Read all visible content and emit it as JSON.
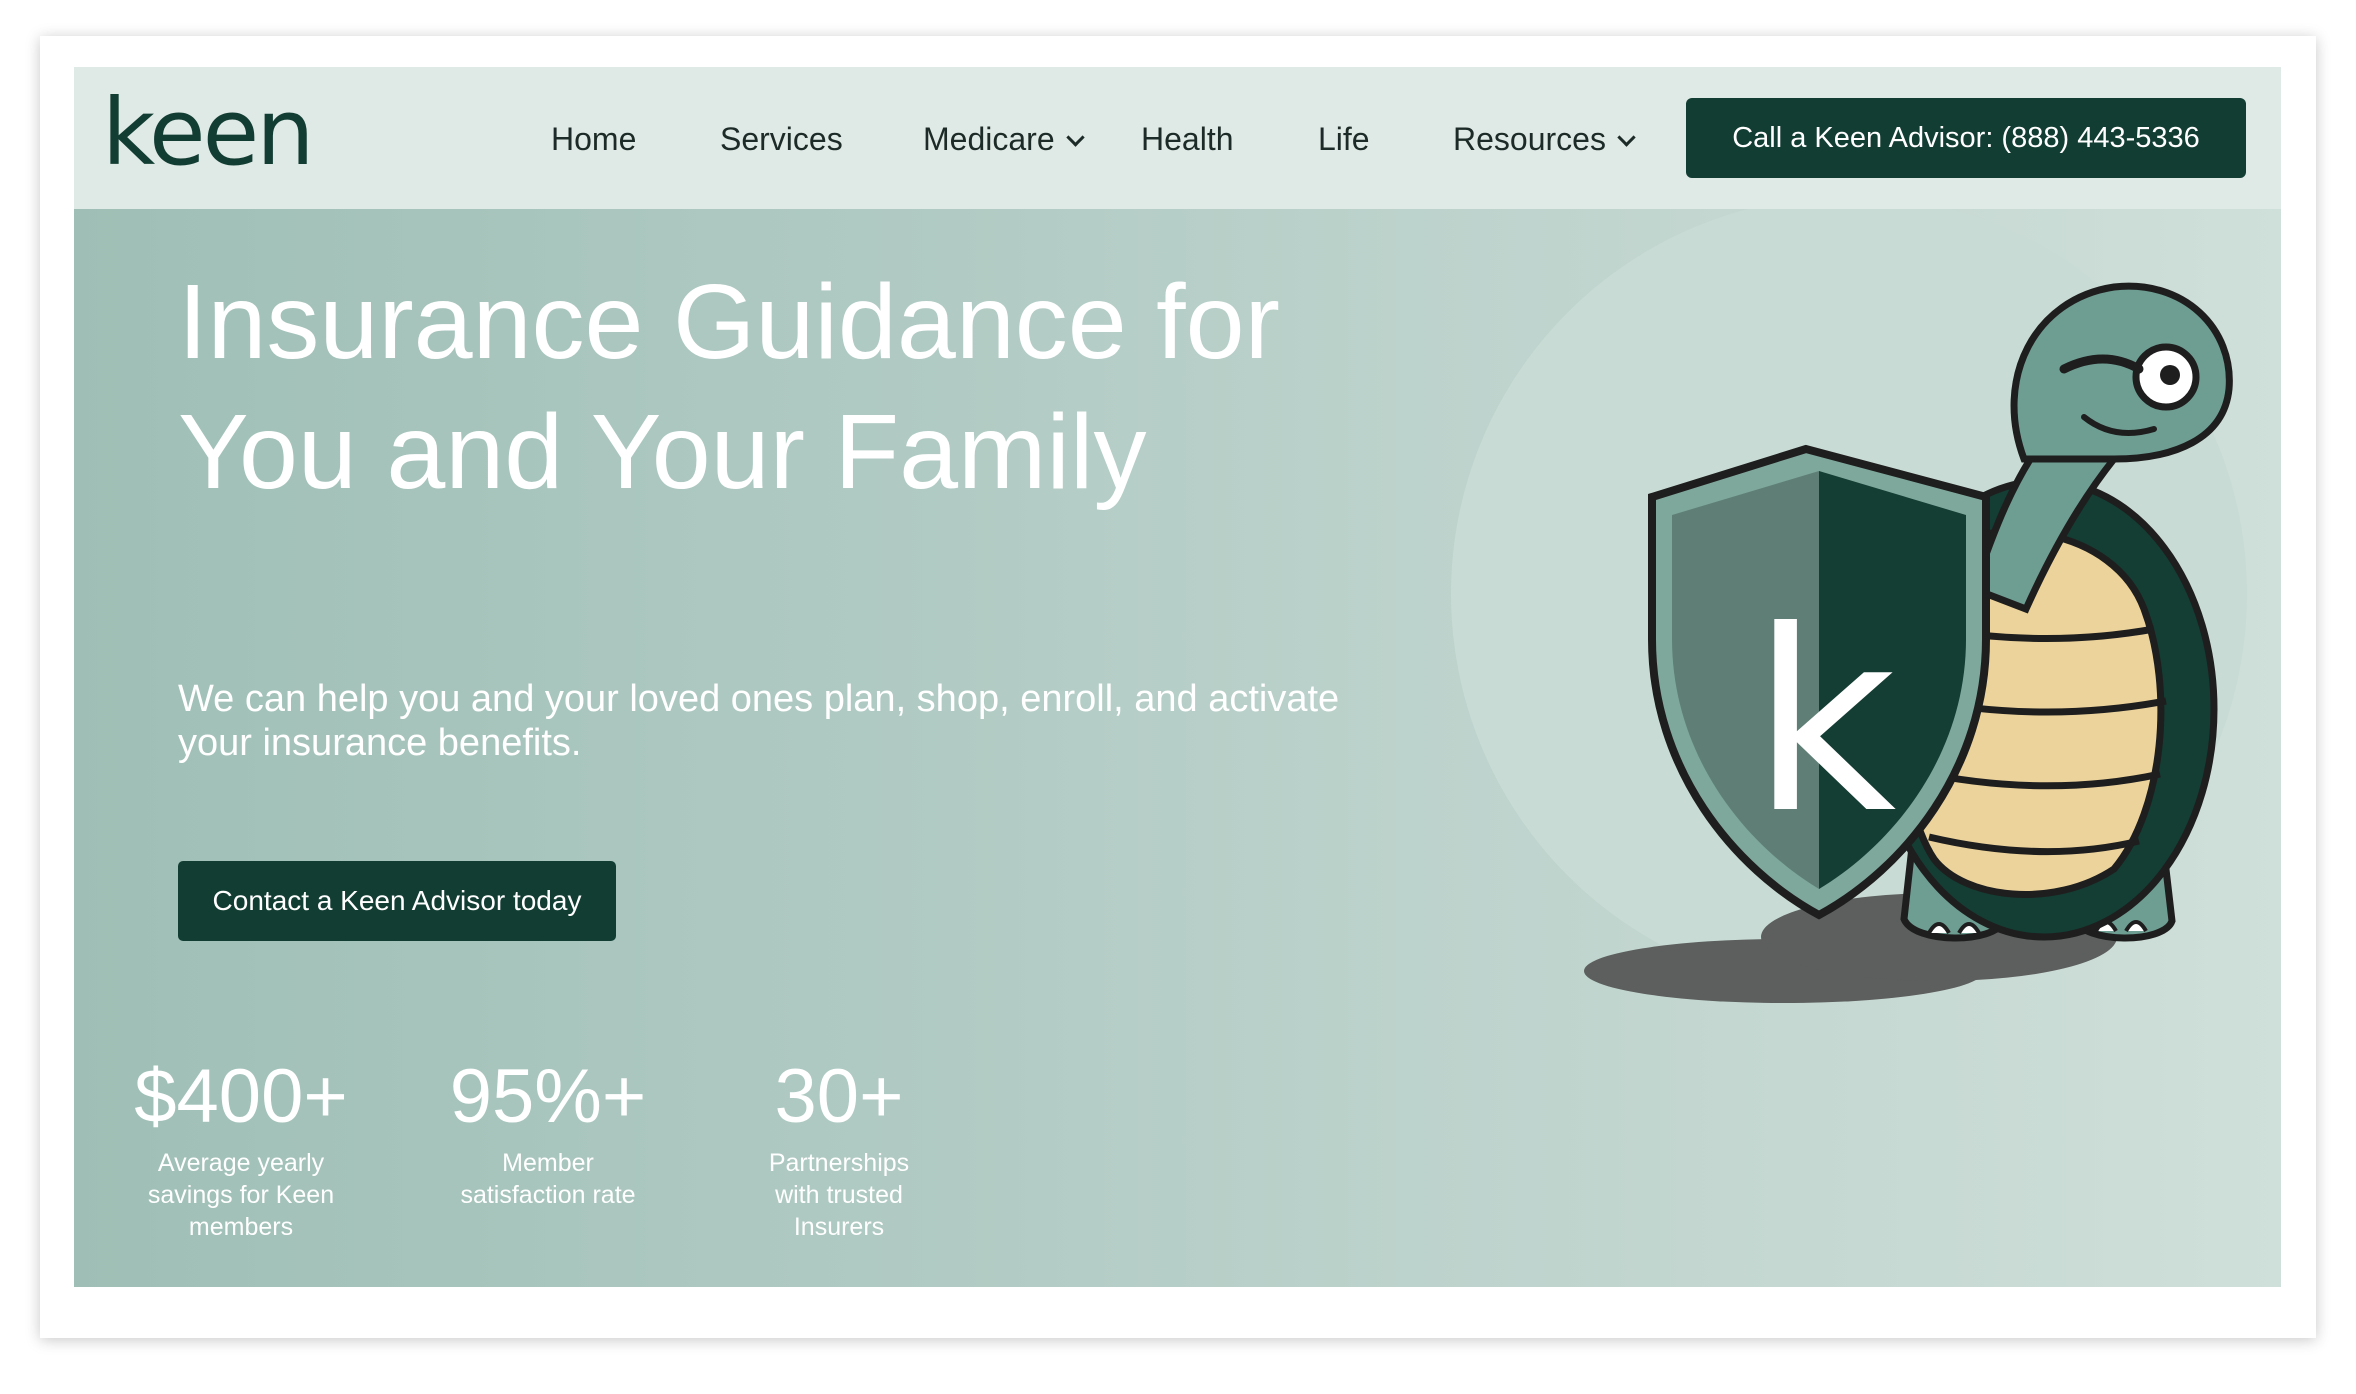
{
  "header": {
    "logo_text": "keen",
    "nav": [
      {
        "label": "Home",
        "has_dropdown": false
      },
      {
        "label": "Services",
        "has_dropdown": false
      },
      {
        "label": "Medicare",
        "has_dropdown": true
      },
      {
        "label": "Health",
        "has_dropdown": false
      },
      {
        "label": "Life",
        "has_dropdown": false
      },
      {
        "label": "Resources",
        "has_dropdown": true
      }
    ],
    "cta_label": "Call a Keen Advisor: (888) 443-5336"
  },
  "hero": {
    "headline": "Insurance Guidance for You and Your Family",
    "subtext": "We can help you and your loved ones plan, shop, enroll, and activate your insurance benefits.",
    "cta_label": "Contact a Keen Advisor today",
    "mascot_letter": "k",
    "stats": [
      {
        "value": "$400+",
        "label": "Average yearly savings for Keen members"
      },
      {
        "value": "95%+",
        "label": "Member satisfaction rate"
      },
      {
        "value": "30+",
        "label": "Partnerships with trusted Insurers"
      }
    ]
  },
  "colors": {
    "brand_dark": "#123d33",
    "nav_bg": "#dfe9e5",
    "hero_bg": "#b1cbc4",
    "turtle_skin": "#6e9d92",
    "turtle_shell": "#ecd39c"
  }
}
